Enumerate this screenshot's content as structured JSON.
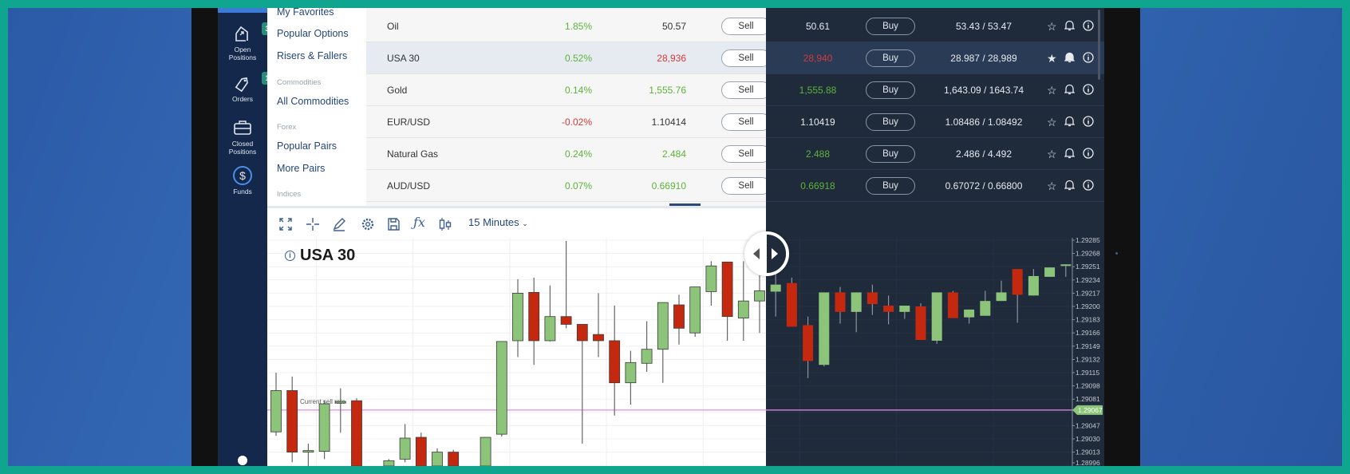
{
  "sidebar": {
    "items": [
      {
        "label1": "Open",
        "label2": "Positions",
        "icon": "open-positions-icon",
        "badge": "3"
      },
      {
        "label1": "Orders",
        "label2": "",
        "icon": "tag-icon",
        "badge": "1"
      },
      {
        "label1": "Closed",
        "label2": "Positions",
        "icon": "briefcase-icon"
      },
      {
        "label1": "Funds",
        "label2": "",
        "icon": "dollar-icon"
      }
    ]
  },
  "nav": {
    "my_favorites": "My Favorites",
    "popular_options": "Popular Options",
    "risers_fallers": "Risers & Fallers",
    "commodities_header": "Commodities",
    "all_commodities": "All Commodities",
    "forex_header": "Forex",
    "popular_pairs": "Popular Pairs",
    "more_pairs": "More Pairs",
    "indices_header": "Indices"
  },
  "table": {
    "sell_label": "Sell",
    "buy_label": "Buy",
    "rows": [
      {
        "name": "Oil",
        "change": "1.85%",
        "change_dir": "up",
        "sell": "50.57",
        "sell_dir": "none",
        "sell2": "50.61",
        "sell2_dir": "none",
        "range": "53.43 / 53.47",
        "fav": false
      },
      {
        "name": "USA 30",
        "change": "0.52%",
        "change_dir": "up",
        "sell": "28,936",
        "sell_dir": "down",
        "sell2": "28,940",
        "sell2_dir": "down",
        "range": "28.987 / 28,989",
        "fav": true,
        "selected": true
      },
      {
        "name": "Gold",
        "change": "0.14%",
        "change_dir": "up",
        "sell": "1,555.76",
        "sell_dir": "up",
        "sell2": "1,555.88",
        "sell2_dir": "up",
        "range": "1,643.09 / 1643.74",
        "fav": false
      },
      {
        "name": "EUR/USD",
        "change": "-0.02%",
        "change_dir": "down",
        "sell": "1.10414",
        "sell_dir": "none",
        "sell2": "1.10419",
        "sell2_dir": "none",
        "range": "1.08486 / 1.08492",
        "fav": false
      },
      {
        "name": "Natural Gas",
        "change": "0.24%",
        "change_dir": "up",
        "sell": "2.484",
        "sell_dir": "up",
        "sell2": "2.488",
        "sell2_dir": "up",
        "range": "2.486 / 4.492",
        "fav": false
      },
      {
        "name": "AUD/USD",
        "change": "0.07%",
        "change_dir": "up",
        "sell": "0.66910",
        "sell_dir": "up",
        "sell2": "0.66918",
        "sell2_dir": "up",
        "range": "0.67072 / 0.66800",
        "fav": false
      }
    ]
  },
  "toolbar": {
    "interval": "15 Minutes",
    "icons": [
      "fullscreen-icon",
      "crosshair-icon",
      "draw-icon",
      "settings-icon",
      "save-icon",
      "function-icon",
      "candle-type-icon"
    ]
  },
  "colors": {
    "teal": "#0fa58f",
    "up": "#8cc47a",
    "down": "#c4290f",
    "sell_rate_line": "#e58be8",
    "dark_bg": "#1f2b3b"
  },
  "chart_data": {
    "type": "candlestick",
    "title": "USA 30",
    "current_sell_rate_label": "Current sell rate",
    "current_price": "1.29067",
    "current_price_value": 1.29067,
    "ylim": [
      1.28996,
      1.29285
    ],
    "yticks": [
      "1.29285",
      "1.29268",
      "1.29251",
      "1.29234",
      "1.29217",
      "1.29200",
      "1.29183",
      "1.29166",
      "1.29149",
      "1.29132",
      "1.29115",
      "1.29098",
      "1.29081",
      "1.29047",
      "1.29030",
      "1.29013",
      "1.28996"
    ],
    "ohlc": [
      [
        1.29039,
        1.29115,
        1.29034,
        1.29092
      ],
      [
        1.29092,
        1.2911,
        1.29,
        1.29013
      ],
      [
        1.29014,
        1.29024,
        1.2899,
        1.29015
      ],
      [
        1.29014,
        1.29079,
        1.29004,
        1.29075
      ],
      [
        1.29076,
        1.29095,
        1.29038,
        1.29078
      ],
      [
        1.29079,
        1.29082,
        1.28955,
        1.28965
      ],
      [
        1.2898,
        1.28985,
        1.28929,
        1.28939
      ],
      [
        1.28965,
        1.29004,
        1.2896,
        1.29002
      ],
      [
        1.29004,
        1.29049,
        1.29,
        1.29031
      ],
      [
        1.29032,
        1.29038,
        1.2896,
        1.2897
      ],
      [
        1.2897,
        1.29018,
        1.28965,
        1.29013
      ],
      [
        1.29013,
        1.29016,
        1.2896,
        1.28968
      ],
      [
        1.28965,
        1.28985,
        1.28955,
        1.2898
      ],
      [
        1.28975,
        1.29032,
        1.2897,
        1.29032
      ],
      [
        1.29036,
        1.29155,
        1.29033,
        1.29155
      ],
      [
        1.29156,
        1.29235,
        1.29135,
        1.29217
      ],
      [
        1.29218,
        1.29237,
        1.29125,
        1.29156
      ],
      [
        1.29156,
        1.29227,
        1.29155,
        1.29187
      ],
      [
        1.29187,
        1.29284,
        1.29172,
        1.29177
      ],
      [
        1.29177,
        1.29177,
        1.29024,
        1.29156
      ],
      [
        1.29164,
        1.29217,
        1.29135,
        1.29156
      ],
      [
        1.29156,
        1.29201,
        1.2906,
        1.29102
      ],
      [
        1.29102,
        1.29143,
        1.29074,
        1.29128
      ],
      [
        1.29127,
        1.29181,
        1.29116,
        1.29145
      ],
      [
        1.29145,
        1.29205,
        1.29102,
        1.29205
      ],
      [
        1.29202,
        1.29215,
        1.29151,
        1.29172
      ],
      [
        1.29166,
        1.29225,
        1.29161,
        1.29225
      ],
      [
        1.29219,
        1.29258,
        1.29201,
        1.29252
      ],
      [
        1.29257,
        1.29257,
        1.29156,
        1.29187
      ],
      [
        1.29185,
        1.29258,
        1.29156,
        1.29207
      ],
      [
        1.29207,
        1.2924,
        1.29166,
        1.2922
      ],
      [
        1.29219,
        1.29242,
        1.29187,
        1.29228
      ],
      [
        1.2923,
        1.29237,
        1.29174,
        1.29174
      ],
      [
        1.29176,
        1.29187,
        1.29108,
        1.2913
      ],
      [
        1.29125,
        1.29218,
        1.29123,
        1.29218
      ],
      [
        1.29218,
        1.29225,
        1.29178,
        1.29193
      ],
      [
        1.29193,
        1.29218,
        1.29167,
        1.29218
      ],
      [
        1.29218,
        1.29228,
        1.29189,
        1.29203
      ],
      [
        1.29201,
        1.29214,
        1.29177,
        1.29193
      ],
      [
        1.29193,
        1.29201,
        1.29184,
        1.29201
      ],
      [
        1.292,
        1.29204,
        1.29157,
        1.29157
      ],
      [
        1.29156,
        1.29218,
        1.29152,
        1.29218
      ],
      [
        1.29218,
        1.2922,
        1.29185,
        1.29185
      ],
      [
        1.29186,
        1.29196,
        1.29178,
        1.29196
      ],
      [
        1.29188,
        1.2922,
        1.29188,
        1.29207
      ],
      [
        1.29207,
        1.29233,
        1.29207,
        1.29218
      ],
      [
        1.29248,
        1.29248,
        1.29179,
        1.29215
      ],
      [
        1.29214,
        1.29248,
        1.29214,
        1.29239
      ],
      [
        1.29238,
        1.2925,
        1.29238,
        1.2925
      ],
      [
        1.29252,
        1.29254,
        1.29238,
        1.29254
      ]
    ]
  }
}
